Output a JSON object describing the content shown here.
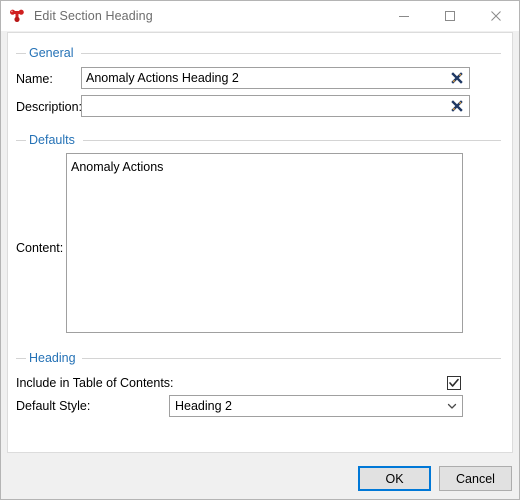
{
  "window": {
    "title": "Edit Section Heading",
    "icon": "app-icon",
    "controls": [
      {
        "name": "minimize",
        "glyph": "minimize-icon"
      },
      {
        "name": "maximize",
        "glyph": "maximize-icon"
      },
      {
        "name": "close",
        "glyph": "close-icon"
      }
    ]
  },
  "colors": {
    "group_label": "#2572b6",
    "accent": "#0078d7",
    "title_text": "#6d6d6d",
    "panel": "#ffffff",
    "footer": "#f0f0f0",
    "border": "#a0a0a0"
  },
  "general": {
    "group_label": "General",
    "name": {
      "label": "Name:",
      "value": "Anomaly Actions Heading 2",
      "placeholder": "",
      "clear_icon": "clear-x-icon"
    },
    "description": {
      "label": "Description:",
      "value": "",
      "placeholder": "",
      "clear_icon": "clear-x-icon"
    }
  },
  "defaults": {
    "group_label": "Defaults",
    "content": {
      "label": "Content:",
      "value": "Anomaly Actions"
    }
  },
  "heading": {
    "group_label": "Heading",
    "include_toc": {
      "label": "Include in Table of Contents:",
      "checked": true,
      "check_icon": "checkmark-icon"
    },
    "default_style": {
      "label": "Default Style:",
      "value": "Heading 2",
      "arrow_icon": "chevron-down-icon",
      "options": [
        "Heading 2"
      ]
    }
  },
  "footer": {
    "ok_label": "OK",
    "cancel_label": "Cancel"
  }
}
